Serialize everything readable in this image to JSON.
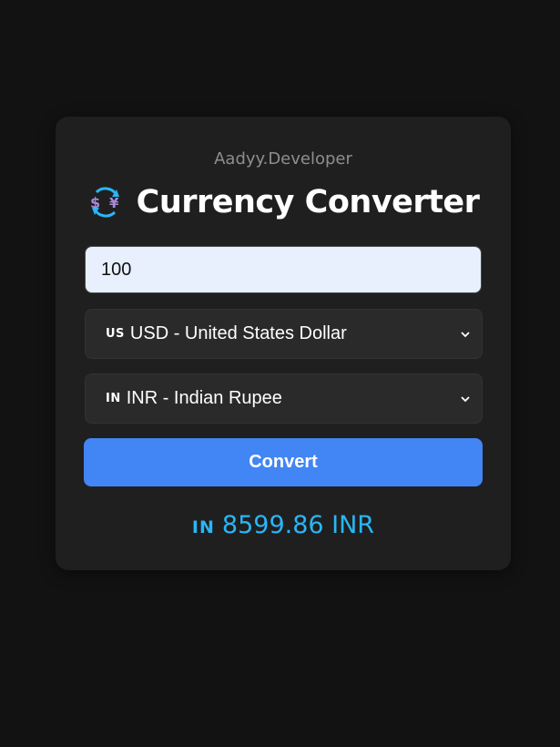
{
  "app": {
    "brand": "Aadyy.Developer",
    "title": "Currency Converter"
  },
  "amount": {
    "value": "100"
  },
  "from_currency": {
    "flag": "US",
    "selected": "USD - United States Dollar"
  },
  "to_currency": {
    "flag": "IN",
    "selected": "INR - Indian Rupee"
  },
  "convert_button": {
    "label": "Convert"
  },
  "result": {
    "flag": "IN",
    "text": "8599.86 INR"
  },
  "icons": {
    "title_icon": "currency-exchange-icon",
    "dropdown_icon": "chevron-down-icon"
  },
  "colors": {
    "background": "#121212",
    "card": "#1f1f1f",
    "accent": "#4285f4",
    "result": "#29b6f6"
  }
}
